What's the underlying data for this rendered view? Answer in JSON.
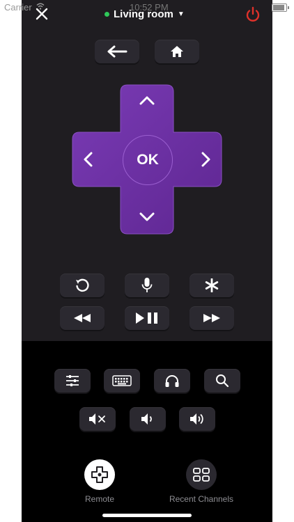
{
  "status_bar": {
    "carrier": "Carrier",
    "time": "10:52 PM"
  },
  "header": {
    "room": "Living room",
    "connection_status_color": "#2fc95a",
    "power_color": "#e0312a"
  },
  "dpad": {
    "ok_label": "OK",
    "color": "#6b2fa2"
  },
  "icons": {
    "close": "close-icon",
    "back": "back-arrow-icon",
    "home": "home-icon",
    "replay": "replay-icon",
    "voice": "microphone-icon",
    "options": "asterisk-icon",
    "rewind": "rewind-icon",
    "play_pause": "play-pause-icon",
    "fast_forward": "fast-forward-icon",
    "settings": "sliders-icon",
    "keyboard": "keyboard-icon",
    "private_listening": "headphones-icon",
    "search": "search-icon",
    "mute": "mute-icon",
    "volume_down": "volume-down-icon",
    "volume_up": "volume-up-icon"
  },
  "tabs": [
    {
      "label": "Remote",
      "active": true
    },
    {
      "label": "Recent Channels",
      "active": false
    }
  ]
}
